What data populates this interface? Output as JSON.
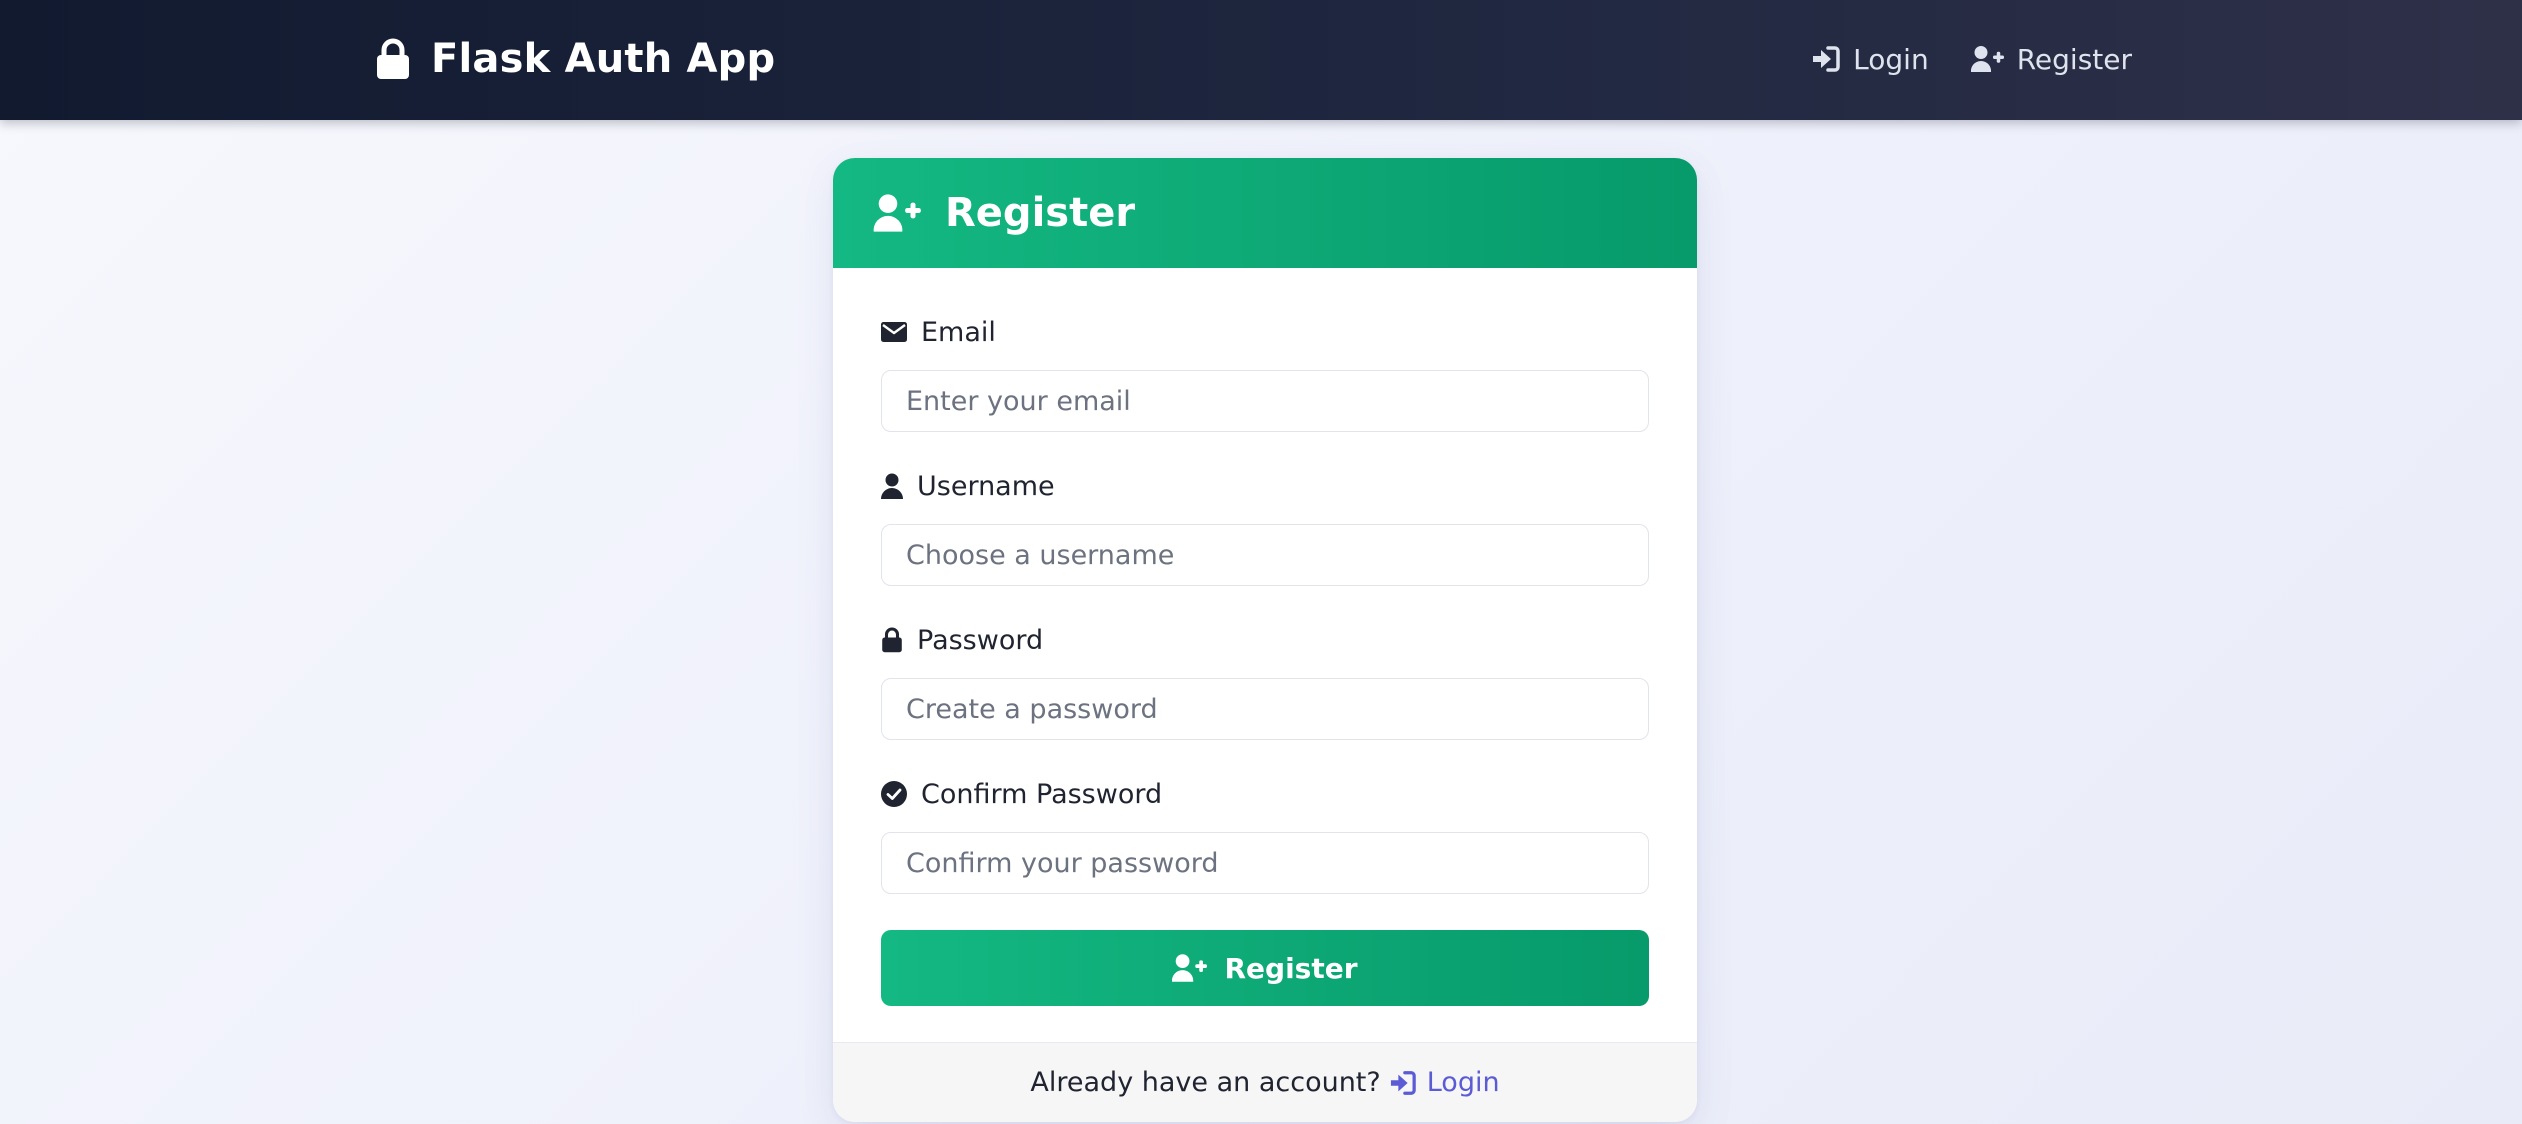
{
  "navbar": {
    "brand": {
      "text": "Flask Auth App",
      "icon": "lock-icon"
    },
    "links": [
      {
        "label": "Login",
        "icon": "sign-in-icon"
      },
      {
        "label": "Register",
        "icon": "user-plus-icon"
      }
    ]
  },
  "card": {
    "title": "Register",
    "title_icon": "user-plus-icon",
    "fields": [
      {
        "label": "Email",
        "icon": "envelope-icon",
        "placeholder": "Enter your email",
        "value": ""
      },
      {
        "label": "Username",
        "icon": "user-icon",
        "placeholder": "Choose a username",
        "value": ""
      },
      {
        "label": "Password",
        "icon": "lock-icon",
        "placeholder": "Create a password",
        "value": ""
      },
      {
        "label": "Confirm Password",
        "icon": "check-circle-icon",
        "placeholder": "Confirm your password",
        "value": ""
      }
    ],
    "submit_label": "Register",
    "footer": {
      "text": "Already have an account?",
      "link_label": "Login",
      "link_icon": "sign-in-icon"
    }
  },
  "colors": {
    "navbar_start": "#121a30",
    "navbar_end": "#2e3048",
    "accent_green_start": "#14b882",
    "accent_green_end": "#079a6a",
    "link_purple": "#5b5bd6",
    "page_background": "#eef0fb"
  }
}
